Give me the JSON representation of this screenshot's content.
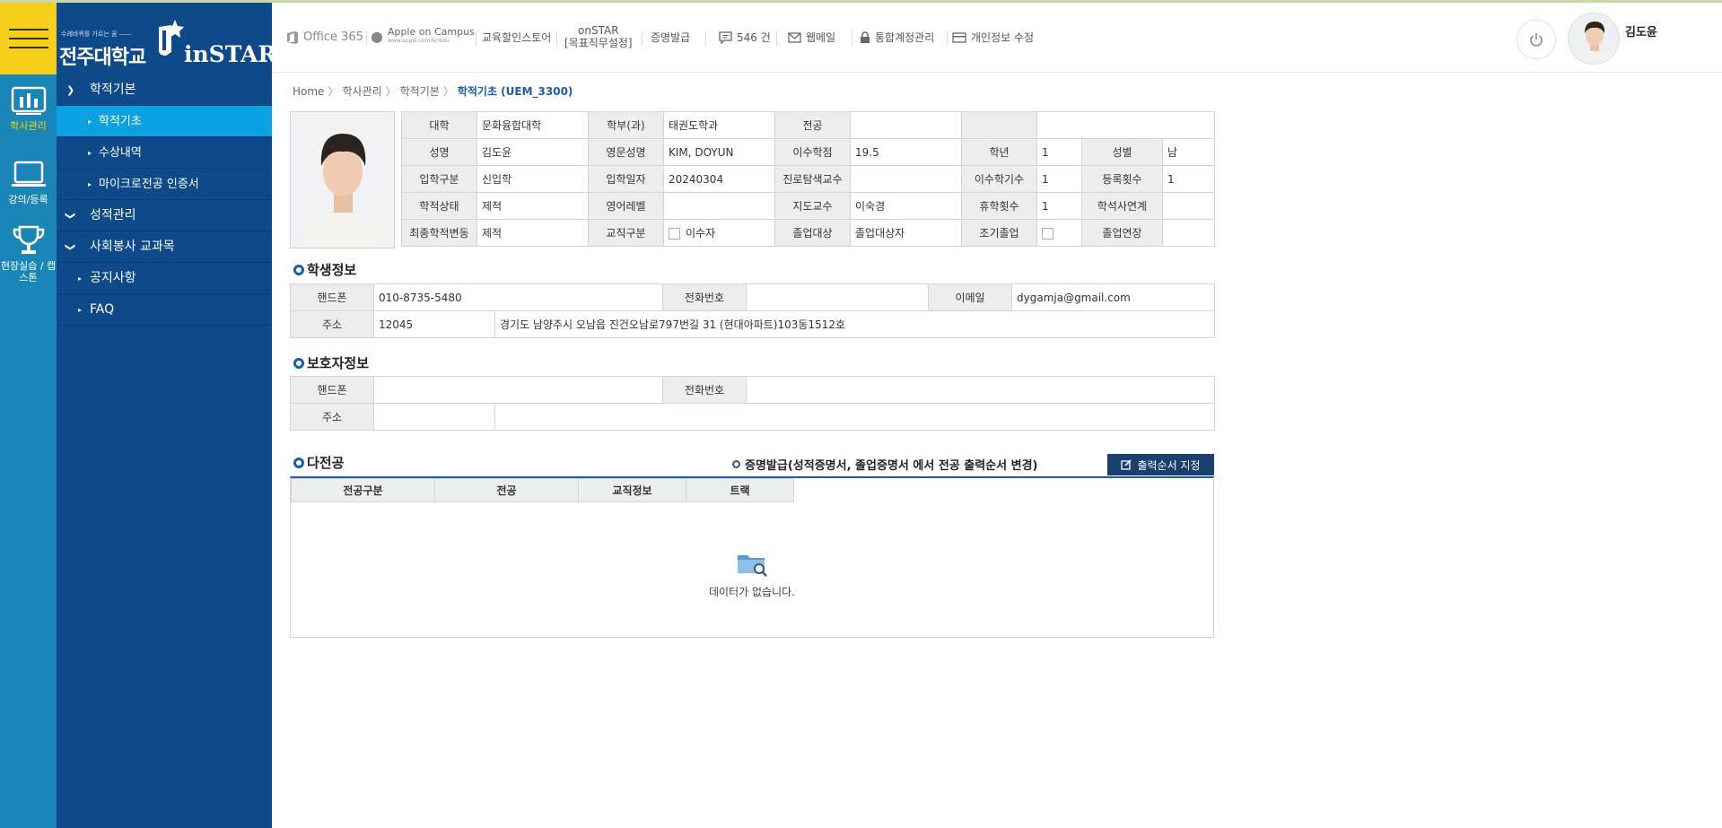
{
  "rail": {
    "items": [
      {
        "label": "학사관리"
      },
      {
        "label": "강의/등록"
      },
      {
        "label": "현장실습 / 캡스톤"
      }
    ]
  },
  "logo": {
    "slogan": "수레바퀴를 가르는 꿈 ——",
    "university": "전주대학교",
    "brand": "inSTAR"
  },
  "sidebar": {
    "items": [
      {
        "label": "학적기본",
        "level": 1,
        "icon": "chevron-right"
      },
      {
        "label": "학적기초",
        "level": 2,
        "active": true
      },
      {
        "label": "수상내역",
        "level": 2
      },
      {
        "label": "마이크로전공 인증서",
        "level": 2
      },
      {
        "label": "성적관리",
        "level": 1,
        "icon": "chevron-down"
      },
      {
        "label": "사회봉사 교과목",
        "level": 1,
        "icon": "chevron-down"
      },
      {
        "label": "공지사항",
        "level": 1
      },
      {
        "label": "FAQ",
        "level": 1
      }
    ]
  },
  "header": {
    "office": "Office 365",
    "apple": "Apple on Campus",
    "apple_sub": "www.apple.com/kr/edu",
    "edu_store": "교육할인스토어",
    "onstar1": "onSTAR",
    "onstar2": "[목표직무설정]",
    "cert": "증명발급",
    "messages": "546 건",
    "webmail": "웹메일",
    "account": "통합계정관리",
    "profile": "개인정보 수정",
    "username": "김도윤"
  },
  "breadcrumb": {
    "home": "Home",
    "l1": "학사관리",
    "l2": "학적기본",
    "current": "학적기초 (UEM_3300)"
  },
  "info": {
    "college_label": "대학",
    "college": "문화융합대학",
    "dept_label": "학부(과)",
    "dept": "태권도학과",
    "major_label": "전공",
    "major": "",
    "name_label": "성명",
    "name": "김도윤",
    "en_name_label": "영문성명",
    "en_name": "KIM, DOYUN",
    "credits_label": "이수학점",
    "credits": "19.5",
    "grade_label": "학년",
    "grade": "1",
    "gender_label": "성별",
    "gender": "남",
    "entry_type_label": "입학구분",
    "entry_type": "신입학",
    "entry_date_label": "입학일자",
    "entry_date": "20240304",
    "career_prof_label": "진로탐색교수",
    "career_prof": "",
    "terms_label": "이수학기수",
    "terms": "1",
    "reg_count_label": "등록횟수",
    "reg_count": "1",
    "status_label": "학적상태",
    "status": "제적",
    "eng_level_label": "영어레벨",
    "eng_level": "",
    "advisor_label": "지도교수",
    "advisor": "이숙경",
    "leave_label": "휴학횟수",
    "leave": "1",
    "link_label": "학석사연계",
    "link": "",
    "last_change_label": "최종학적변동",
    "last_change": "제적",
    "teach_label": "교직구분",
    "teach": "이수자",
    "grad_target_label": "졸업대상",
    "grad_target": "졸업대상자",
    "early_grad_label": "조기졸업",
    "grad_ext_label": "졸업연장",
    "grad_ext": ""
  },
  "student": {
    "title": "학생정보",
    "phone_label": "핸드폰",
    "phone": "010-8735-5480",
    "tel_label": "전화번호",
    "tel": "",
    "email_label": "이메일",
    "email": "dygamja@gmail.com",
    "addr_label": "주소",
    "zip": "12045",
    "address": "경기도 남양주시 오남읍 진건오남로797번길 31 (현대아파트)103동1512호"
  },
  "guardian": {
    "title": "보호자정보",
    "phone_label": "핸드폰",
    "phone": "",
    "tel_label": "전화번호",
    "tel": "",
    "addr_label": "주소",
    "zip": "",
    "address": ""
  },
  "majors": {
    "title": "다전공",
    "note": "증명발급(성적증명서, 졸업증명서 에서 전공 출력순서 변경)",
    "print_button": "출력순서 지정",
    "columns": [
      "전공구분",
      "전공",
      "교직정보",
      "트랙"
    ],
    "empty": "데이터가 없습니다."
  },
  "colors": {
    "rail": "#1a86b7",
    "sidebar": "#0e4a8a",
    "active": "#0aa2e3",
    "accent": "#1a5ea8",
    "hamburger": "#f5cf1b"
  }
}
